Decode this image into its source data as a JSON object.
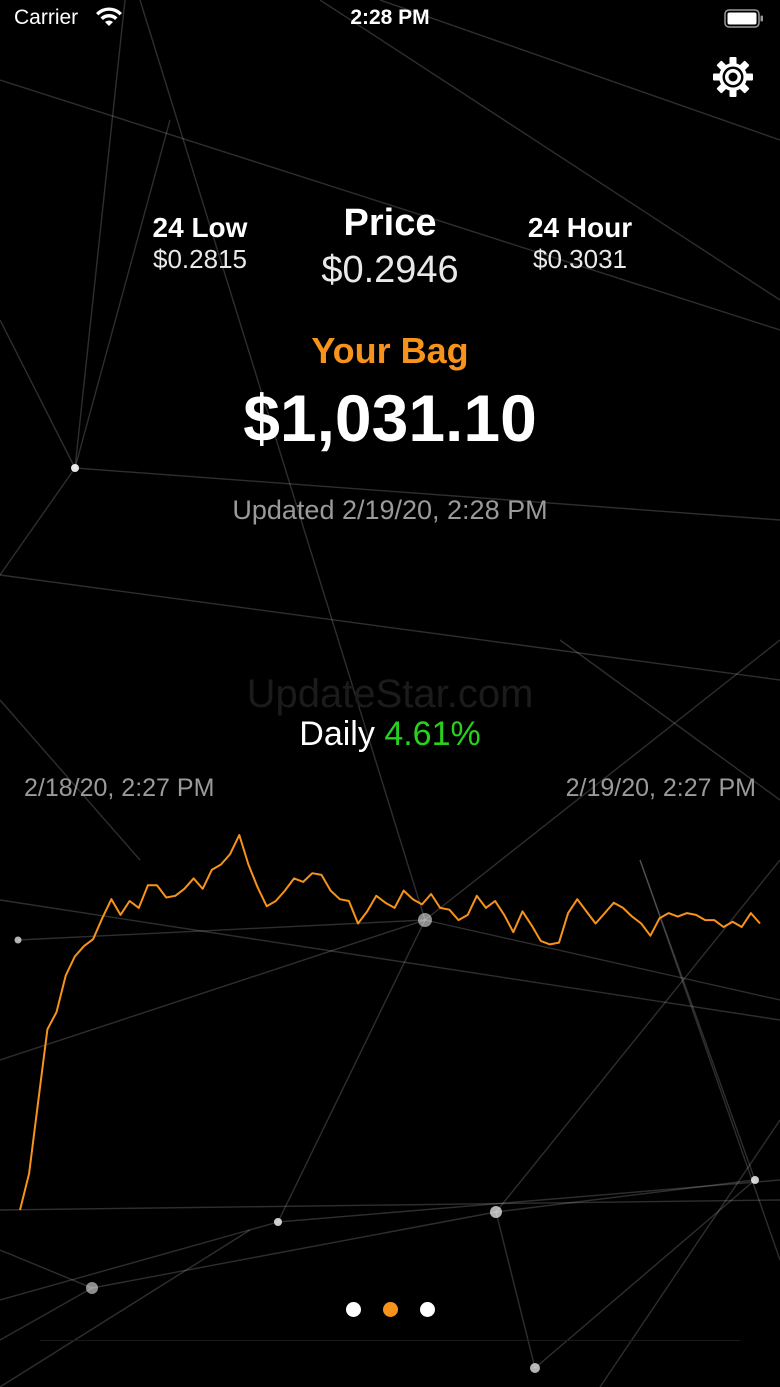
{
  "status_bar": {
    "carrier": "Carrier",
    "time": "2:28 PM"
  },
  "icons": {
    "settings": "gear-icon",
    "wifi": "wifi-icon",
    "battery": "battery-icon"
  },
  "stats": {
    "low_label": "24 Low",
    "low_value": "$0.2815",
    "price_label": "Price",
    "price_value": "$0.2946",
    "hour_label": "24 Hour",
    "hour_value": "$0.3031"
  },
  "bag": {
    "label": "Your Bag",
    "value": "$1,031.10"
  },
  "updated": "Updated 2/19/20, 2:28 PM",
  "watermark": "UpdateStar.com",
  "daily": {
    "label": "Daily",
    "change": "4.61%"
  },
  "colors": {
    "accent": "#f7931a",
    "positive": "#27d11c",
    "background": "#000000"
  },
  "chart_data": {
    "type": "line",
    "x_start_label": "2/18/20, 2:27 PM",
    "x_end_label": "2/19/20, 2:27 PM",
    "xlabel": "",
    "ylabel": "",
    "grid": false,
    "legend": "none",
    "ylim": [
      0.2815,
      0.3031
    ],
    "series": [
      {
        "color": "#f7931a",
        "values": [
          0.2815,
          0.2836,
          0.2878,
          0.2919,
          0.2929,
          0.295,
          0.2961,
          0.2967,
          0.2971,
          0.2983,
          0.2994,
          0.2985,
          0.2993,
          0.2989,
          0.3002,
          0.3002,
          0.2995,
          0.2996,
          0.3,
          0.3006,
          0.3,
          0.3011,
          0.3014,
          0.302,
          0.3031,
          0.3014,
          0.3001,
          0.299,
          0.2993,
          0.2999,
          0.3006,
          0.3004,
          0.3009,
          0.3008,
          0.2999,
          0.2994,
          0.2993,
          0.298,
          0.2987,
          0.2996,
          0.2992,
          0.2989,
          0.2999,
          0.2994,
          0.2991,
          0.2997,
          0.2989,
          0.2988,
          0.2982,
          0.2985,
          0.2996,
          0.2989,
          0.2993,
          0.2985,
          0.2975,
          0.2987,
          0.2979,
          0.297,
          0.2968,
          0.2969,
          0.2986,
          0.2994,
          0.2987,
          0.298,
          0.2986,
          0.2992,
          0.2989,
          0.2984,
          0.298,
          0.2973,
          0.2983,
          0.2986,
          0.2984,
          0.2986,
          0.2985,
          0.2982,
          0.2982,
          0.2978,
          0.2981,
          0.2978,
          0.2986,
          0.298
        ]
      }
    ]
  },
  "pager": {
    "count": 3,
    "active_index": 1
  }
}
